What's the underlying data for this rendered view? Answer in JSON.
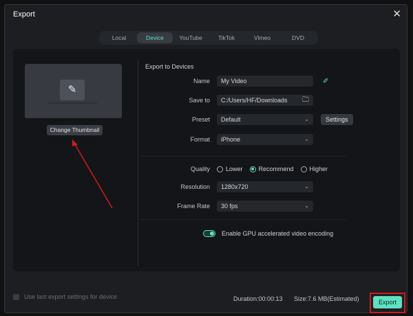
{
  "dialog": {
    "title": "Export"
  },
  "tabs": [
    "Local",
    "Device",
    "YouTube",
    "TikTok",
    "Vimeo",
    "DVD"
  ],
  "active_tab": "Device",
  "thumbnail": {
    "change_label": "Change Thumbnail"
  },
  "section_title": "Export to Devices",
  "fields": {
    "name": {
      "label": "Name",
      "value": "My Video"
    },
    "save_to": {
      "label": "Save to",
      "value": "C:/Users/HF/Downloads"
    },
    "preset": {
      "label": "Preset",
      "value": "Default",
      "settings_label": "Settings"
    },
    "format": {
      "label": "Format",
      "value": "iPhone"
    },
    "quality": {
      "label": "Quality",
      "options": [
        "Lower",
        "Recommend",
        "Higher"
      ],
      "selected": "Recommend"
    },
    "resolution": {
      "label": "Resolution",
      "value": "1280x720"
    },
    "frame_rate": {
      "label": "Frame Rate",
      "value": "30 fps"
    }
  },
  "gpu": {
    "label": "Enable GPU accelerated video encoding",
    "enabled": true
  },
  "footer": {
    "use_last": "Use last export settings for device",
    "duration": "Duration:00:00:13",
    "size": "Size:7.6 MB(Estimated)",
    "export_label": "Export"
  },
  "colors": {
    "accent": "#5ee0c2",
    "highlight": "#d11a1a"
  }
}
